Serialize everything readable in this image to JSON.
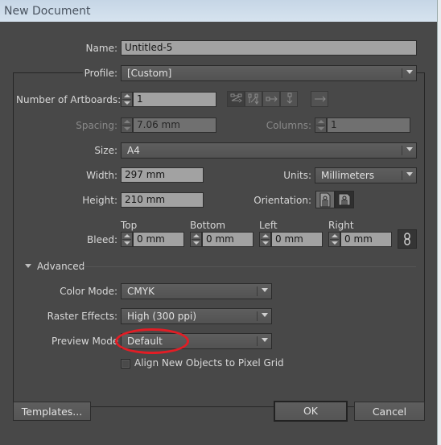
{
  "window": {
    "title": "New Document"
  },
  "name": {
    "label": "Name:",
    "value": "Untitled-5"
  },
  "profile": {
    "label": "Profile:",
    "value": "[Custom]"
  },
  "artboards": {
    "count_label": "Number of Artboards:",
    "count_value": "1",
    "spacing_label": "Spacing:",
    "spacing_value": "7.06 mm",
    "columns_label": "Columns:",
    "columns_value": "1",
    "layout_icons": [
      "grid-by-row-icon",
      "grid-by-column-icon",
      "arrange-by-row-icon",
      "arrange-by-column-icon",
      "change-to-right-to-left-icon"
    ]
  },
  "size": {
    "label": "Size:",
    "value": "A4"
  },
  "width": {
    "label": "Width:",
    "value": "297 mm"
  },
  "height": {
    "label": "Height:",
    "value": "210 mm"
  },
  "units": {
    "label": "Units:",
    "value": "Millimeters"
  },
  "orientation": {
    "label": "Orientation:",
    "options": [
      "Portrait",
      "Landscape"
    ],
    "selected": "Portrait"
  },
  "bleed": {
    "label": "Bleed:",
    "top_label": "Top",
    "top_value": "0 mm",
    "bottom_label": "Bottom",
    "bottom_value": "0 mm",
    "left_label": "Left",
    "left_value": "0 mm",
    "right_label": "Right",
    "right_value": "0 mm"
  },
  "advanced": {
    "label": "Advanced",
    "color_mode_label": "Color Mode:",
    "color_mode_value": "CMYK",
    "raster_label": "Raster Effects:",
    "raster_value": "High (300 ppi)",
    "preview_label": "Preview Mode",
    "preview_value": "Default",
    "align_pixel_grid_label": "Align New Objects to Pixel Grid",
    "align_pixel_grid_checked": false
  },
  "buttons": {
    "templates": "Templates...",
    "ok": "OK",
    "cancel": "Cancel"
  },
  "annotation": {
    "color": "#e21d25",
    "target": "Preview Mode"
  }
}
